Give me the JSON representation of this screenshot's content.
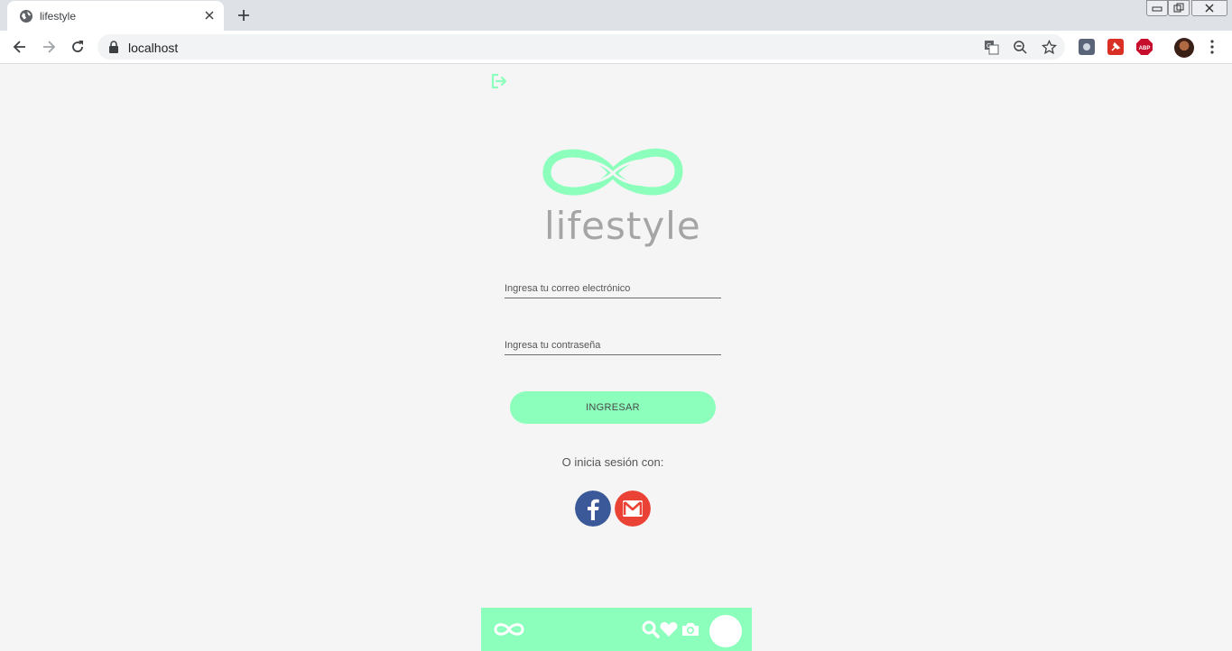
{
  "browser": {
    "tab_title": "lifestyle",
    "url": "localhost",
    "extensions": [
      "puzzle-ext-icon",
      "red-pin-ext-icon",
      "adblock-plus-icon"
    ],
    "adblock_label": "ABP"
  },
  "page": {
    "logo_wordmark": "lifestyle",
    "email_placeholder": "Ingresa tu correo electrónico",
    "password_placeholder": "Ingresa tu contraseña",
    "login_button": "INGRESAR",
    "alt_login_text": "O inicia sesión con:",
    "social": [
      {
        "name": "facebook",
        "color": "#3b5998"
      },
      {
        "name": "gmail",
        "color": "#ea4335"
      }
    ]
  },
  "colors": {
    "accent": "#8bffbb",
    "page_background": "#f5f5f5",
    "wordmark": "#a5a5a5"
  },
  "bottom_nav": {
    "icons": [
      "infinity-logo-icon",
      "search-icon",
      "heart-icon",
      "camera-icon",
      "profile-avatar"
    ]
  }
}
